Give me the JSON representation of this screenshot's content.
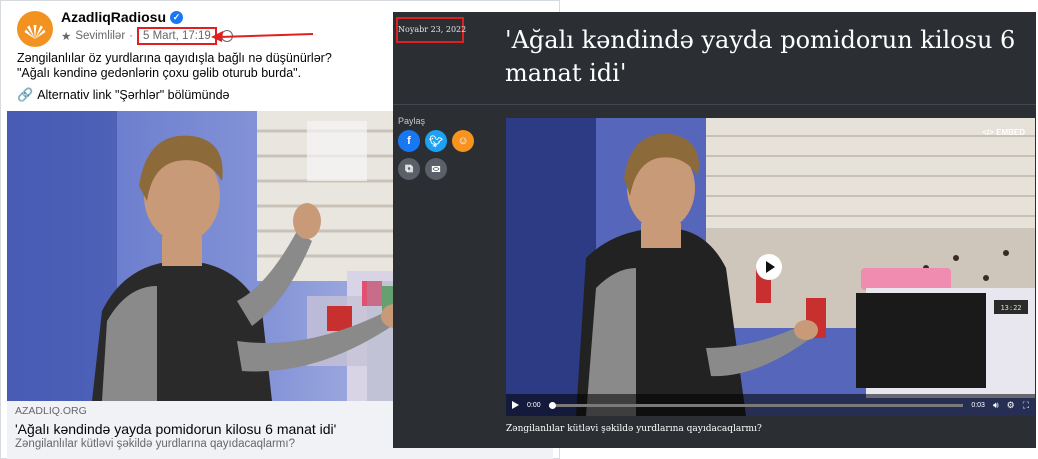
{
  "facebook_post": {
    "page_name": "AzadliqRadiosu",
    "favorites_label": "Sevimlilər",
    "post_date": "5 Mart, 17:19",
    "text_line1": "Zəngilanlılar öz yurdlarına qayıdışla bağlı nə düşünürlər?",
    "text_line2": "\"Ağalı kəndinə gedənlərin çoxu gəlib oturub burda\".",
    "alt_link": "Alternativ link \"Şərhlər\" bölümündə",
    "card_domain": "AZADLIQ.ORG",
    "card_title": "'Ağalı kəndində yayda pomidorun kilosu 6 manat idi'",
    "card_subtitle": "Zəngilanlılar kütləvi şəkildə yurdlarına qayıdacaqlarmı?"
  },
  "article": {
    "date": "Noyabr 23, 2022",
    "title": "'Ağalı kəndində yayda pomidorun kilosu 6 manat idi'",
    "share_label": "Paylaş",
    "embed_label": "</> EMBED",
    "time_current": "0:00",
    "time_total": "0:03",
    "caption": "Zəngilanlılar kütləvi şəkildə yurdlarına qayıdacaqlarmı?",
    "microwave_display": "13:22"
  },
  "colors": {
    "highlight_red": "#e02020",
    "facebook_blue": "#1877f2",
    "twitter_blue": "#1da1f2",
    "ok_orange": "#f7931e",
    "article_bg": "#2b2e33"
  },
  "video_progress_fraction": 0.0
}
